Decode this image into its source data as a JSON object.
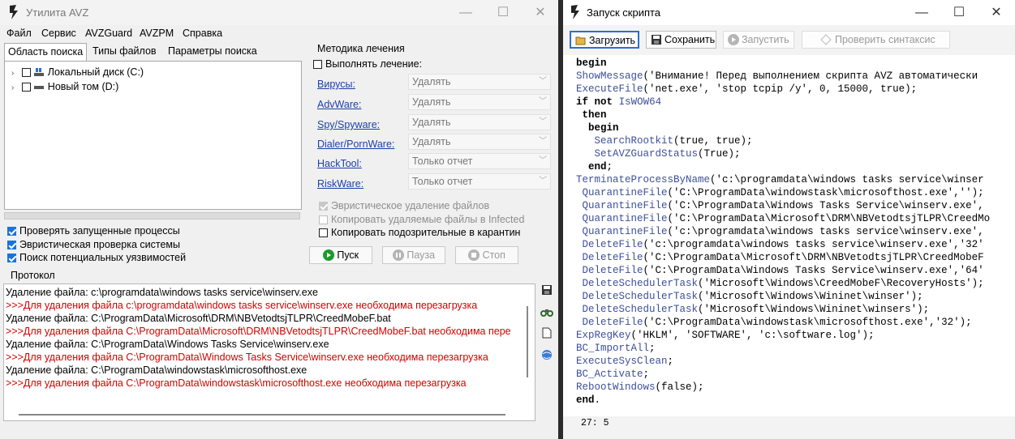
{
  "avz": {
    "title": "Утилита AVZ",
    "menu": [
      "Файл",
      "Сервис",
      "AVZGuard",
      "AVZPM",
      "Справка"
    ],
    "tabs": [
      "Область поиска",
      "Типы файлов",
      "Параметры поиска"
    ],
    "tree": [
      "Локальный диск (C:)",
      "Новый том (D:)"
    ],
    "scan_options": [
      {
        "label": "Проверять запущенные процессы",
        "checked": true
      },
      {
        "label": "Эвристическая проверка системы",
        "checked": true
      },
      {
        "label": "Поиск потенциальных уязвимостей",
        "checked": true
      }
    ],
    "treatment": {
      "group_title": "Методика лечения",
      "perform_label": "Выполнять лечение:",
      "rows": [
        {
          "link": "Вирусы:",
          "value": "Удалять"
        },
        {
          "link": "AdvWare:",
          "value": "Удалять"
        },
        {
          "link": "Spy/Spyware:",
          "value": "Удалять"
        },
        {
          "link": "Dialer/PornWare:",
          "value": "Удалять"
        },
        {
          "link": "HackTool:",
          "value": "Только отчет"
        },
        {
          "link": "RiskWare:",
          "value": "Только отчет"
        }
      ],
      "heuristic_delete": "Эвристическое удаление файлов",
      "copy_deleted": "Копировать удаляемые файлы в  Infected",
      "copy_suspicious": "Копировать подозрительные в  карантин"
    },
    "buttons": {
      "start": "Пуск",
      "pause": "Пауза",
      "stop": "Стоп"
    },
    "protocol_title": "Протокол",
    "log": [
      {
        "text": "Удаление файла: c:\\programdata\\windows tasks service\\winserv.exe",
        "red": false
      },
      {
        "text": ">>>Для удаления файла c:\\programdata\\windows tasks service\\winserv.exe необходима перезагрузка",
        "red": true
      },
      {
        "text": "Удаление файла: C:\\ProgramData\\Microsoft\\DRM\\NBVetodtsjTLPR\\CreedMobeF.bat",
        "red": false
      },
      {
        "text": ">>>Для удаления файла C:\\ProgramData\\Microsoft\\DRM\\NBVetodtsjTLPR\\CreedMobeF.bat необходима пере",
        "red": true
      },
      {
        "text": "Удаление файла: C:\\ProgramData\\Windows Tasks Service\\winserv.exe",
        "red": false
      },
      {
        "text": ">>>Для удаления файла C:\\ProgramData\\Windows Tasks Service\\winserv.exe необходима перезагрузка",
        "red": true
      },
      {
        "text": "Удаление файла: C:\\ProgramData\\windowstask\\microsofthost.exe",
        "red": false
      },
      {
        "text": ">>>Для удаления файла C:\\ProgramData\\windowstask\\microsofthost.exe необходима перезагрузка",
        "red": true
      }
    ]
  },
  "script": {
    "title": "Запуск скрипта",
    "toolbar": {
      "load": "Загрузить",
      "save": "Сохранить",
      "run": "Запустить",
      "check": "Проверить синтаксис"
    },
    "code": [
      "begin",
      "ShowMessage('Внимание! Перед выполнением скрипта AVZ автоматически",
      "ExecuteFile('net.exe', 'stop tcpip /y', 0, 15000, true);",
      "if not IsWOW64",
      " then",
      "  begin",
      "   SearchRootkit(true, true);",
      "   SetAVZGuardStatus(True);",
      "  end;",
      "TerminateProcessByName('c:\\programdata\\windows tasks service\\winser",
      " QuarantineFile('C:\\ProgramData\\windowstask\\microsofthost.exe','');",
      " QuarantineFile('C:\\ProgramData\\Windows Tasks Service\\winserv.exe',",
      " QuarantineFile('C:\\ProgramData\\Microsoft\\DRM\\NBVetodtsjTLPR\\CreedMo",
      " QuarantineFile('c:\\programdata\\windows tasks service\\winserv.exe',",
      " DeleteFile('c:\\programdata\\windows tasks service\\winserv.exe','32'",
      " DeleteFile('C:\\ProgramData\\Microsoft\\DRM\\NBVetodtsjTLPR\\CreedMobeF",
      " DeleteFile('C:\\ProgramData\\Windows Tasks Service\\winserv.exe','64'",
      " DeleteSchedulerTask('Microsoft\\Windows\\CreedMobeF\\RecoveryHosts');",
      " DeleteSchedulerTask('Microsoft\\Windows\\Wininet\\winser');",
      " DeleteSchedulerTask('Microsoft\\Windows\\Wininet\\winsers');",
      " DeleteFile('C:\\ProgramData\\windowstask\\microsofthost.exe','32');",
      "ExpRegKey('HKLM', 'SOFTWARE', 'c:\\software.log');",
      "BC_ImportAll;",
      "ExecuteSysClean;",
      "BC_Activate;",
      "RebootWindows(false);",
      "end."
    ],
    "status": "27: 5"
  },
  "window_controls": {
    "minimize": "—",
    "maximize": "☐",
    "close": "✕"
  }
}
